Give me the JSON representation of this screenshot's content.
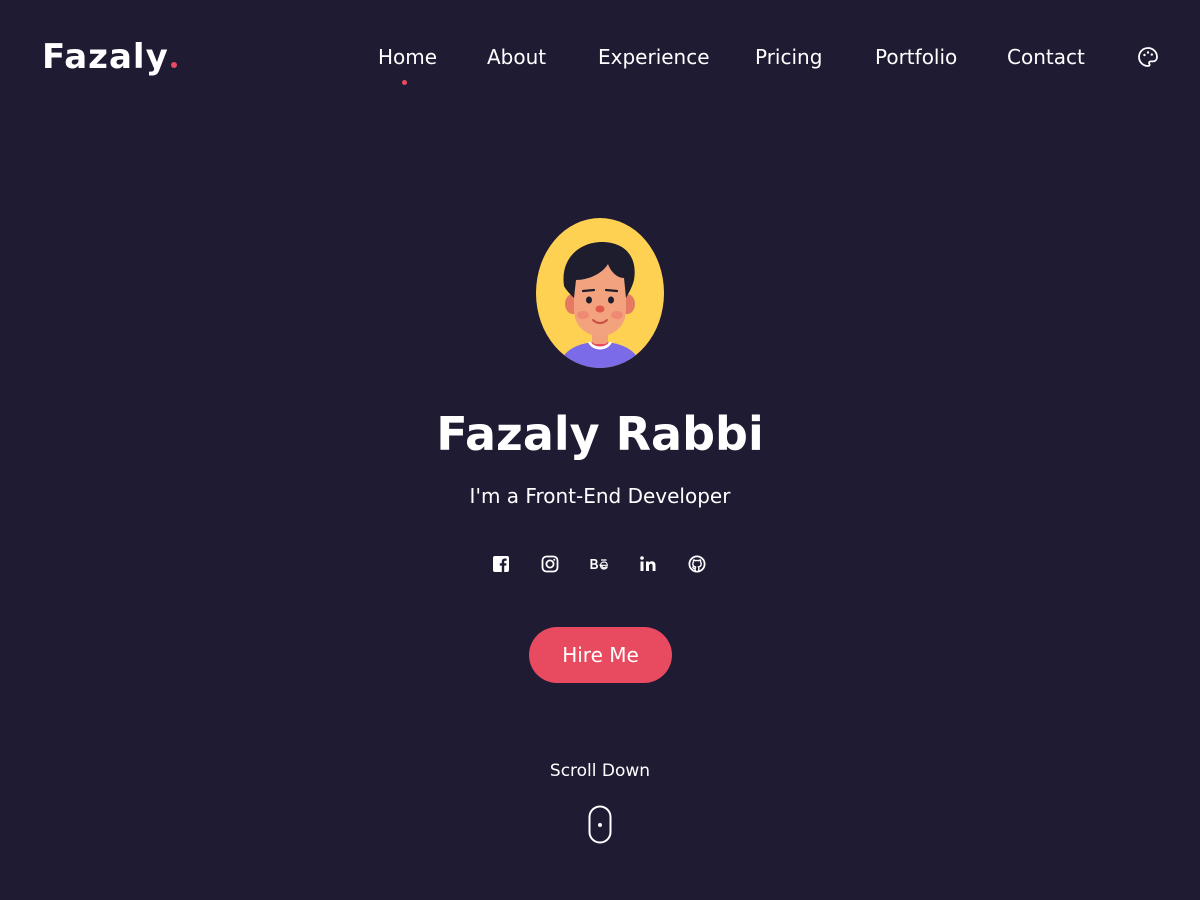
{
  "header": {
    "logo_text": "Fazaly",
    "nav": [
      {
        "label": "Home",
        "active": true
      },
      {
        "label": "About",
        "active": false
      },
      {
        "label": "Experience",
        "active": false
      },
      {
        "label": "Pricing",
        "active": false
      },
      {
        "label": "Portfolio",
        "active": false
      },
      {
        "label": "Contact",
        "active": false
      }
    ],
    "theme_toggle_icon": "palette-icon"
  },
  "hero": {
    "avatar_icon": "avatar-illustration",
    "name": "Fazaly Rabbi",
    "tagline": "I'm a Front-End Developer",
    "socials": [
      {
        "icon": "facebook-icon"
      },
      {
        "icon": "instagram-icon"
      },
      {
        "icon": "behance-icon"
      },
      {
        "icon": "linkedin-icon"
      },
      {
        "icon": "github-icon"
      }
    ],
    "cta_label": "Hire Me",
    "scroll_label": "Scroll Down",
    "scroll_icon": "mouse-icon"
  },
  "colors": {
    "background": "#1f1b33",
    "accent": "#e84a5f",
    "text": "#ffffff",
    "avatar_bg": "#ffd152"
  }
}
